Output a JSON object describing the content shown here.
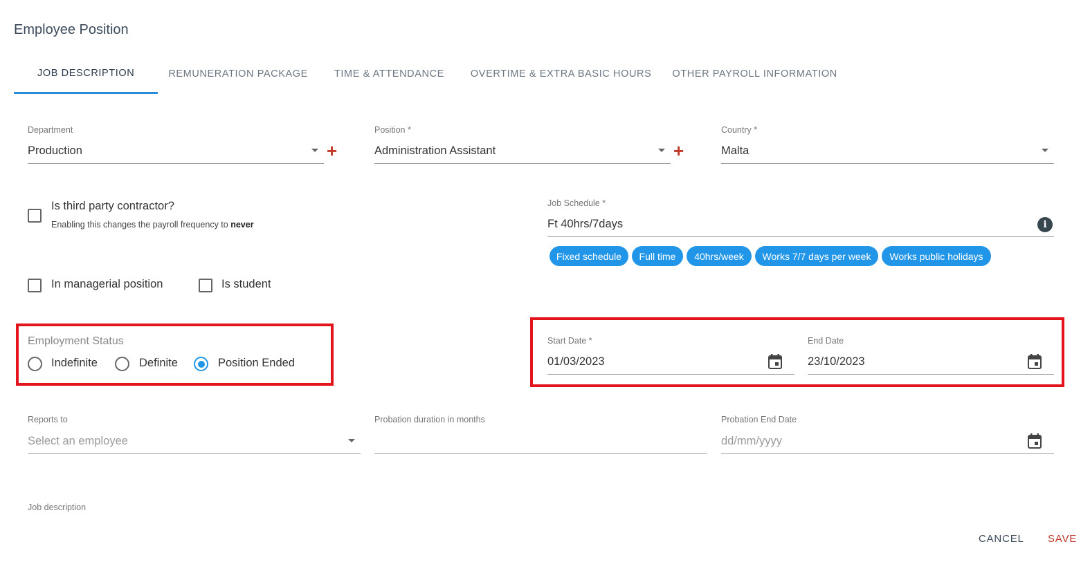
{
  "page": {
    "title": "Employee Position"
  },
  "tabs": [
    {
      "label": "JOB DESCRIPTION"
    },
    {
      "label": "REMUNERATION PACKAGE"
    },
    {
      "label": "TIME & ATTENDANCE"
    },
    {
      "label": "OVERTIME & EXTRA BASIC HOURS"
    },
    {
      "label": "OTHER PAYROLL INFORMATION"
    }
  ],
  "active_tab": "JOB DESCRIPTION",
  "fields": {
    "department": {
      "label": "Department",
      "value": "Production"
    },
    "position": {
      "label": "Position *",
      "value": "Administration Assistant"
    },
    "country": {
      "label": "Country *",
      "value": "Malta"
    },
    "job_schedule": {
      "label": "Job Schedule *",
      "value": "Ft 40hrs/7days"
    },
    "start_date": {
      "label": "Start Date *",
      "value": "01/03/2023"
    },
    "end_date": {
      "label": "End Date",
      "value": "23/10/2023"
    },
    "reports_to": {
      "label": "Reports to",
      "placeholder": "Select an employee"
    },
    "probation_duration": {
      "label": "Probation duration in months",
      "value": ""
    },
    "probation_end": {
      "label": "Probation End Date",
      "placeholder": "dd/mm/yyyy"
    },
    "job_description": {
      "label": "Job description"
    }
  },
  "schedule_tags": [
    "Fixed schedule",
    "Full time",
    "40hrs/week",
    "Works 7/7 days per week",
    "Works public holidays"
  ],
  "checkboxes": {
    "third_party": {
      "label": "Is third party contractor?",
      "help_prefix": "Enabling this changes the payroll frequency to",
      "help_bold": "never",
      "checked": false
    },
    "managerial": {
      "label": "In managerial position",
      "checked": false
    },
    "student": {
      "label": "Is student",
      "checked": false
    }
  },
  "employment_status": {
    "label": "Employment Status",
    "options": [
      "Indefinite",
      "Definite",
      "Position Ended"
    ],
    "selected": "Position Ended"
  },
  "actions": {
    "cancel": "CANCEL",
    "save": "SAVE"
  },
  "colors": {
    "accent": "#2196e8",
    "highlight": "#e3141b",
    "save": "#c0392b",
    "add": "#c0392b"
  },
  "icons": {
    "add": "plus-icon",
    "info": "info-icon",
    "calendar": "calendar-icon",
    "dropdown": "chevron-down-icon"
  }
}
